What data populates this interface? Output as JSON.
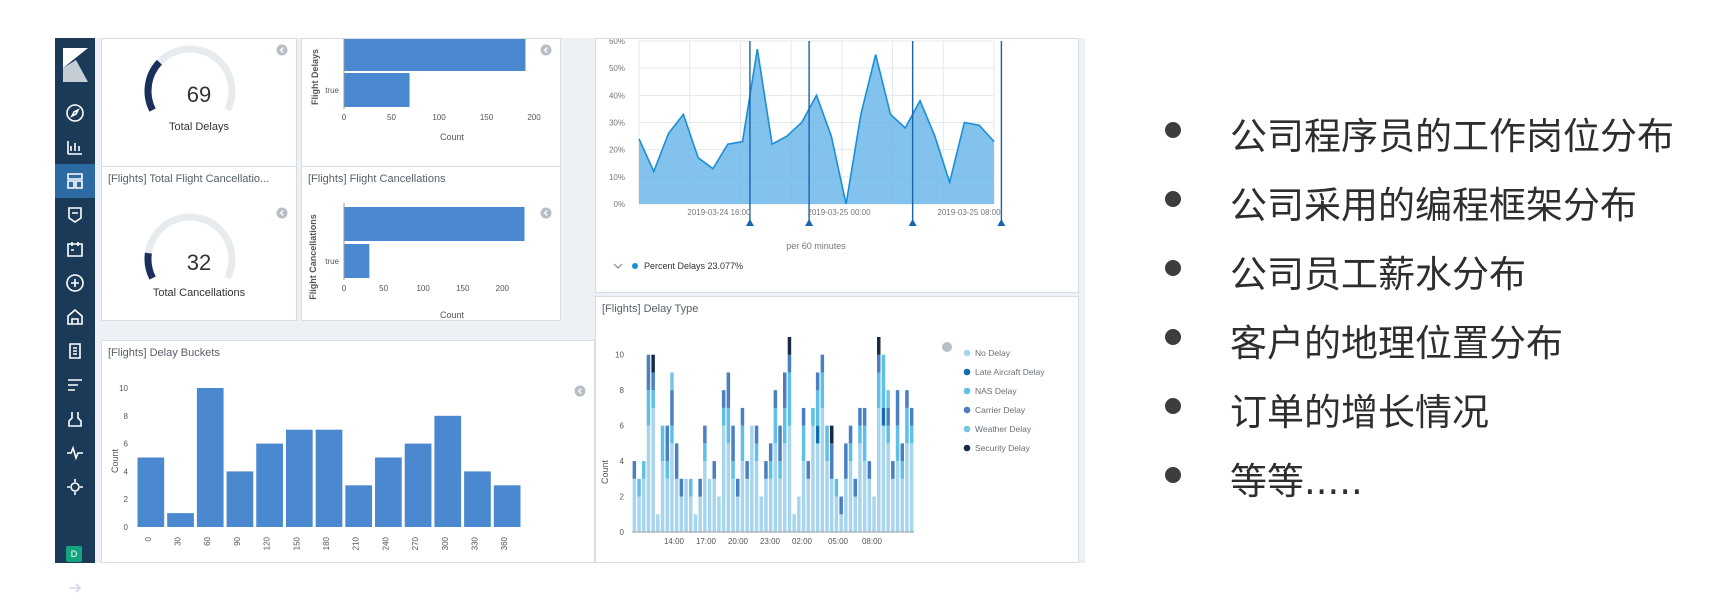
{
  "sidebar": {
    "icons": [
      "discover-icon",
      "visualize-icon",
      "dashboard-icon",
      "canvas-icon",
      "maps-icon",
      "ml-icon",
      "infrastructure-icon",
      "logs-icon",
      "apm-icon",
      "dev-tools-icon",
      "monitoring-icon",
      "management-icon"
    ],
    "active_index": 2,
    "user_initial": "D"
  },
  "panels": {
    "total_delays": {
      "value": "69",
      "label": "Total Delays",
      "fraction": 0.3
    },
    "total_cancellations": {
      "title": "[Flights] Total Flight Cancellatio...",
      "value": "32",
      "label": "Total Cancellations",
      "fraction": 0.15
    },
    "flight_delays": {
      "ylabel": "Flight Delays",
      "xlabel": "Count",
      "category_label": "true"
    },
    "flight_cancellations": {
      "title": "[Flights] Flight Cancellations",
      "ylabel": "Flight Cancellations",
      "xlabel": "Count",
      "category_label": "true"
    },
    "percent_delays": {
      "legend": "Percent Delays 23.077%",
      "xaxis_caption": "per 60 minutes"
    },
    "delay_buckets": {
      "title": "[Flights] Delay Buckets",
      "ylabel": "Count"
    },
    "delay_type": {
      "title": "[Flights] Delay Type",
      "ylabel": "Count"
    }
  },
  "chart_data": [
    {
      "type": "bar",
      "orientation": "horizontal",
      "xlabel": "Count",
      "ylabel": "Flight Delays",
      "categories": [
        "false",
        "true"
      ],
      "values": [
        191,
        69
      ],
      "xticks": [
        0,
        50,
        100,
        150,
        200
      ],
      "xlim": [
        0,
        200
      ]
    },
    {
      "type": "bar",
      "orientation": "horizontal",
      "xlabel": "Count",
      "ylabel": "Flight Cancellations",
      "categories": [
        "false",
        "true"
      ],
      "values": [
        228,
        32
      ],
      "xticks": [
        0,
        50,
        100,
        150,
        200
      ],
      "xlim": [
        0,
        240
      ]
    },
    {
      "type": "area",
      "ylim": [
        0,
        60
      ],
      "yticks": [
        0,
        10,
        20,
        30,
        40,
        50,
        60
      ],
      "y_unit": "%",
      "x_tick_labels": [
        "2019-03-24 16:00",
        "2019-03-25 00:00",
        "2019-03-25 08:00"
      ],
      "values": [
        24,
        12,
        26,
        33,
        17,
        13,
        22,
        23,
        57,
        22,
        25,
        30,
        40,
        25,
        0,
        33,
        55,
        33,
        28,
        38,
        25,
        8,
        30,
        29,
        23
      ],
      "series": [
        {
          "name": "Percent Delays 23.077%"
        }
      ],
      "annotations": [
        8,
        12,
        19,
        25
      ]
    },
    {
      "type": "bar",
      "ylabel": "Count",
      "categories": [
        "0",
        "30",
        "60",
        "90",
        "120",
        "150",
        "180",
        "210",
        "240",
        "270",
        "300",
        "330",
        "360"
      ],
      "values": [
        5,
        1,
        10,
        4,
        6,
        7,
        7,
        3,
        5,
        6,
        8,
        4,
        3
      ],
      "ylim": [
        0,
        10
      ],
      "yticks": [
        0,
        2,
        4,
        6,
        8,
        10
      ]
    },
    {
      "type": "bar",
      "stacked": true,
      "ylabel": "Count",
      "ylim": [
        0,
        11
      ],
      "yticks": [
        0,
        2,
        4,
        6,
        8,
        10
      ],
      "x_tick_labels": [
        "14:00",
        "17:00",
        "20:00",
        "23:00",
        "02:00",
        "05:00",
        "08:00"
      ],
      "series": [
        {
          "name": "No Delay",
          "color": "#a8d5ee",
          "values": [
            3,
            2,
            3,
            6,
            7,
            1,
            4,
            3,
            5,
            3,
            2,
            3,
            2,
            1,
            2,
            4,
            3,
            3,
            2,
            6,
            5,
            3,
            2,
            4,
            3,
            6,
            4,
            2,
            3,
            3,
            5,
            3,
            5,
            6,
            1,
            2,
            4,
            3,
            6,
            5,
            7,
            4,
            3,
            2,
            1,
            3,
            4,
            2,
            5,
            4,
            3,
            2,
            7,
            6,
            5,
            3,
            4,
            3,
            5,
            5
          ]
        },
        {
          "name": "Late Aircraft Delay",
          "color": "#0f6fb0",
          "values": [
            0,
            0,
            0,
            0,
            0,
            0,
            0,
            0,
            0,
            0,
            0,
            0,
            0,
            0,
            0,
            0,
            0,
            0,
            0,
            0,
            0,
            0,
            0,
            0,
            0,
            0,
            0,
            0,
            0,
            0,
            0,
            0,
            0,
            0,
            0,
            0,
            0,
            0,
            0,
            1,
            0,
            0,
            0,
            0,
            0,
            0,
            0,
            0,
            0,
            0,
            0,
            0,
            0,
            1,
            0,
            0,
            0,
            0,
            0,
            0
          ]
        },
        {
          "name": "NAS Delay",
          "color": "#5fbfe6",
          "values": [
            0,
            1,
            1,
            2,
            1,
            0,
            2,
            1,
            1,
            0,
            0,
            0,
            1,
            0,
            0,
            1,
            0,
            0,
            0,
            1,
            2,
            1,
            0,
            2,
            0,
            0,
            1,
            0,
            0,
            1,
            2,
            1,
            2,
            3,
            0,
            0,
            2,
            0,
            1,
            2,
            2,
            2,
            0,
            1,
            0,
            0,
            1,
            0,
            1,
            2,
            0,
            0,
            2,
            3,
            1,
            0,
            2,
            1,
            2,
            1
          ]
        },
        {
          "name": "Carrier Delay",
          "color": "#4a7fc1",
          "values": [
            1,
            0,
            0,
            2,
            1,
            0,
            0,
            2,
            2,
            2,
            1,
            0,
            0,
            0,
            1,
            1,
            0,
            1,
            0,
            1,
            2,
            2,
            1,
            1,
            1,
            0,
            1,
            0,
            1,
            1,
            1,
            2,
            2,
            1,
            0,
            0,
            1,
            1,
            0,
            1,
            1,
            0,
            2,
            0,
            1,
            2,
            1,
            1,
            1,
            1,
            1,
            0,
            1,
            0,
            1,
            1,
            2,
            1,
            1,
            1
          ]
        },
        {
          "name": "Weather Delay",
          "color": "#74c6e5",
          "values": [
            0,
            0,
            0,
            0,
            0,
            0,
            0,
            0,
            1,
            0,
            0,
            0,
            0,
            0,
            0,
            0,
            0,
            0,
            0,
            0,
            0,
            0,
            0,
            0,
            0,
            0,
            0,
            0,
            0,
            0,
            0,
            0,
            0,
            0,
            0,
            0,
            0,
            0,
            0,
            0,
            0,
            0,
            0,
            0,
            0,
            0,
            0,
            0,
            0,
            0,
            0,
            0,
            0,
            0,
            1,
            0,
            0,
            0,
            0,
            0
          ]
        },
        {
          "name": "Security Delay",
          "color": "#1a2a44",
          "values": [
            0,
            0,
            0,
            0,
            1,
            0,
            0,
            0,
            0,
            0,
            0,
            0,
            0,
            0,
            0,
            0,
            0,
            0,
            0,
            0,
            0,
            0,
            0,
            0,
            0,
            0,
            0,
            0,
            0,
            0,
            0,
            0,
            0,
            1,
            0,
            0,
            0,
            0,
            0,
            0,
            0,
            0,
            1,
            0,
            0,
            0,
            0,
            0,
            0,
            0,
            0,
            0,
            1,
            0,
            0,
            0,
            0,
            0,
            0,
            0
          ]
        }
      ]
    }
  ],
  "bullets": [
    "公司程序员的工作岗位分布",
    "公司采用的编程框架分布",
    "公司员工薪水分布",
    "客户的地理位置分布",
    "订单的增长情况",
    "等等....."
  ]
}
